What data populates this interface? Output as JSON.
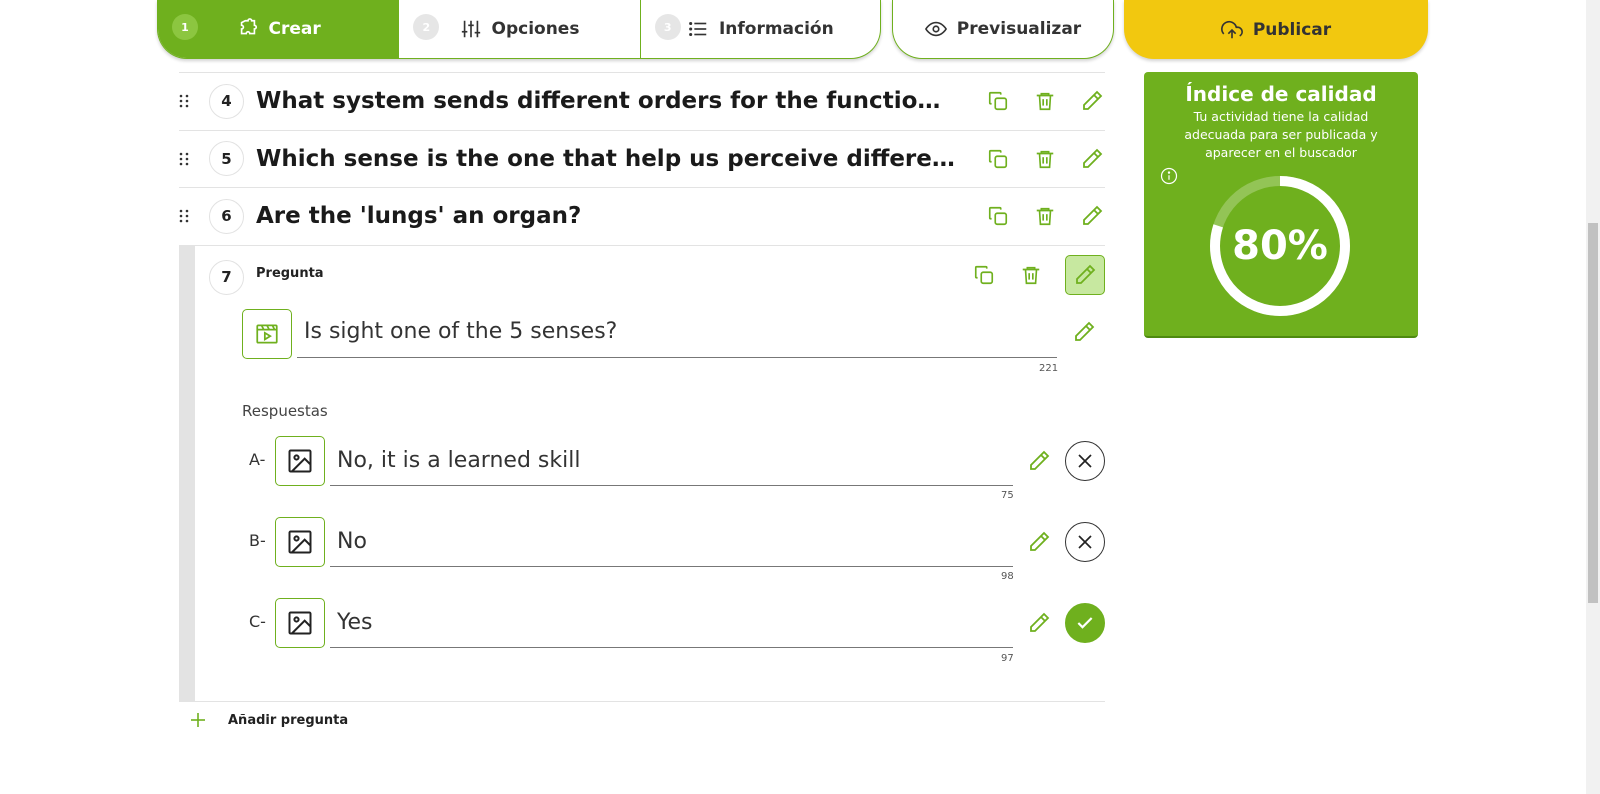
{
  "nav": {
    "steps": [
      {
        "num": "1",
        "label": "Crear",
        "icon": "puzzle-icon"
      },
      {
        "num": "2",
        "label": "Opciones",
        "icon": "sliders-icon"
      },
      {
        "num": "3",
        "label": "Información",
        "icon": "list-icon"
      }
    ],
    "preview_label": "Previsualizar",
    "publish_label": "Publicar"
  },
  "questions": [
    {
      "num": "4",
      "text": "What system sends different orders for the functioning of t..."
    },
    {
      "num": "5",
      "text": "Which sense is the one that help us perceive different flav..."
    },
    {
      "num": "6",
      "text": "Are the 'lungs' an organ?"
    }
  ],
  "expanded": {
    "num": "7",
    "label": "Pregunta",
    "question_text": "Is sight one of the 5 senses?",
    "question_count": "221",
    "answers_label": "Respuestas",
    "answers": [
      {
        "letter": "A-",
        "text": "No, it is a learned skill",
        "count": "75",
        "correct": false
      },
      {
        "letter": "B-",
        "text": "No",
        "count": "98",
        "correct": false
      },
      {
        "letter": "C-",
        "text": "Yes",
        "count": "97",
        "correct": true
      }
    ]
  },
  "add_question_label": "Añadir pregunta",
  "quality": {
    "title": "Índice de calidad",
    "description": "Tu actividad tiene la calidad adecuada para ser publicada y aparecer en el buscador",
    "percent_label": "80%",
    "percent_value": 0.8
  },
  "colors": {
    "accent": "#6fb01e",
    "publish": "#f2c80f"
  }
}
